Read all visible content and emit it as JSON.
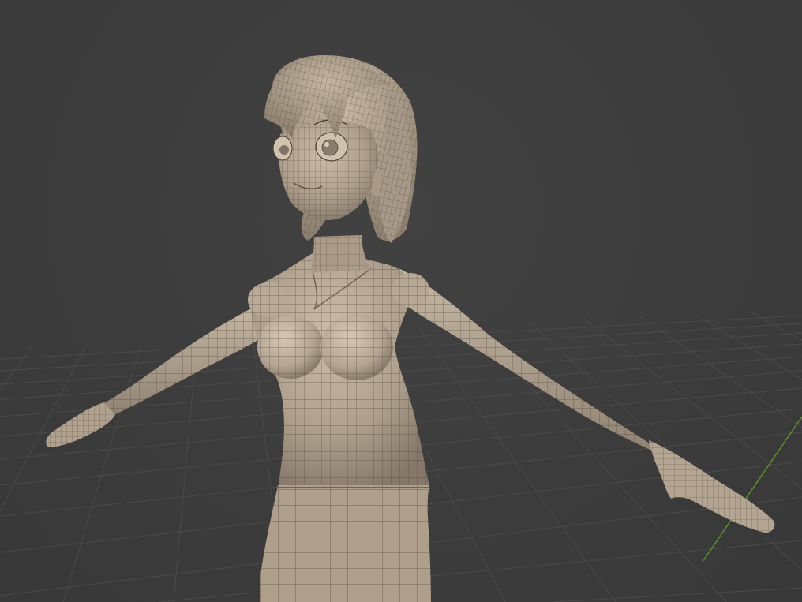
{
  "viewport": {
    "background_color": "#3d3d3d",
    "grid_line_color": "#4a4a4a",
    "axis_y_color": "#5f8f2a"
  },
  "model": {
    "description_icon": "character-mesh-icon",
    "surface_color": "#b8aa98",
    "surface_shadow_color": "#7d705f",
    "wireframe_color": "#4a4034"
  }
}
